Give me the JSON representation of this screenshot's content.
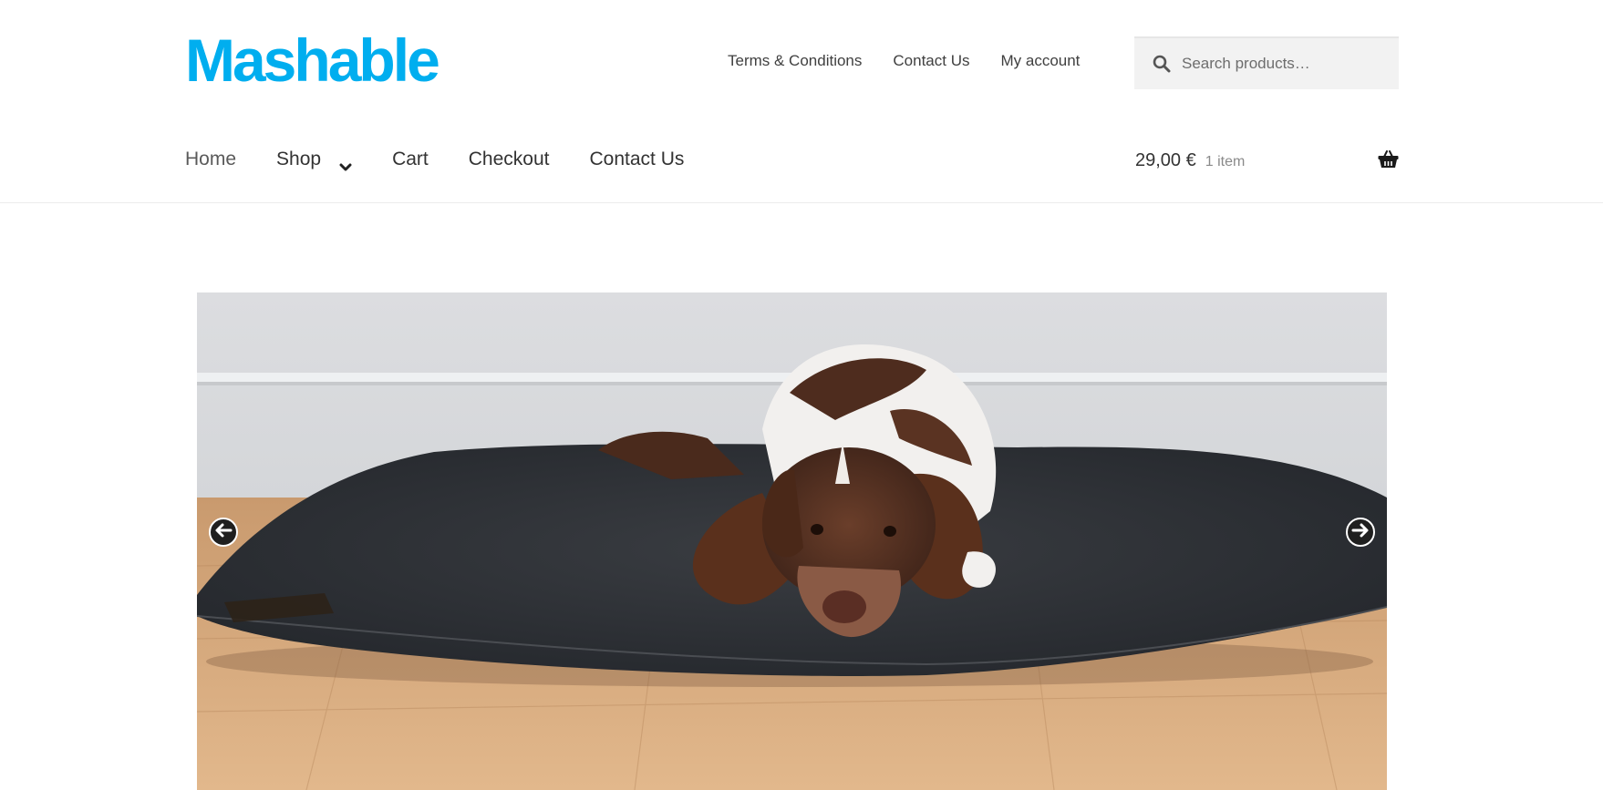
{
  "brand": {
    "logo_text": "Mashable",
    "logo_color": "#00aeef"
  },
  "secondary_nav": {
    "items": [
      {
        "label": "Terms & Conditions"
      },
      {
        "label": "Contact Us"
      },
      {
        "label": "My account"
      }
    ]
  },
  "search": {
    "placeholder": "Search products…",
    "icon": "search-icon"
  },
  "primary_nav": {
    "items": [
      {
        "label": "Home"
      },
      {
        "label": "Shop",
        "has_dropdown": true
      },
      {
        "label": "Cart"
      },
      {
        "label": "Checkout"
      },
      {
        "label": "Contact Us"
      }
    ]
  },
  "cart": {
    "amount": "29,00 €",
    "count_label": "1 item",
    "icon": "basket-icon"
  },
  "slider": {
    "prev_icon": "arrow-left-icon",
    "next_icon": "arrow-right-icon",
    "slide_image": "dog-on-cushion-photo"
  }
}
